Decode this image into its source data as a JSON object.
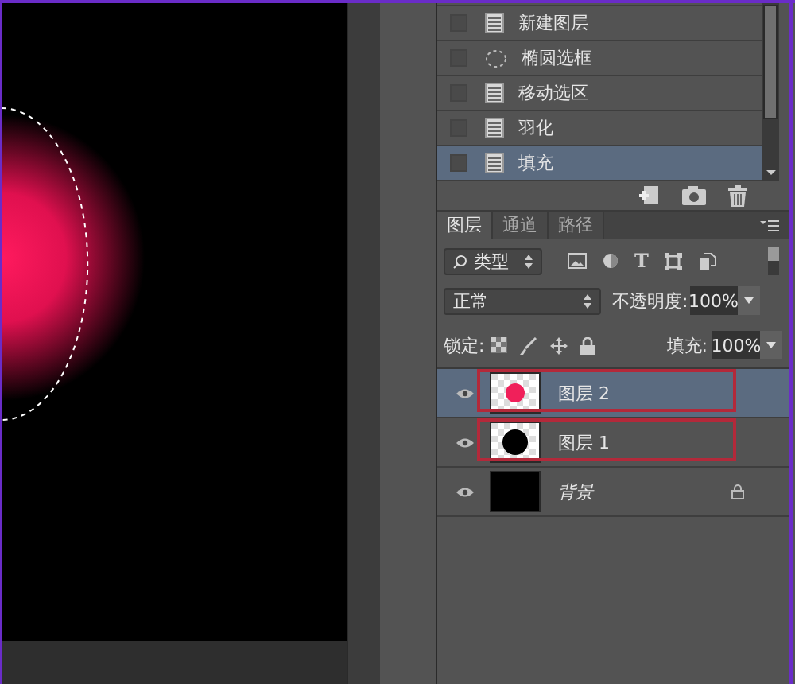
{
  "history": {
    "items": [
      {
        "label": "新建图层",
        "kind": "document",
        "selected": false
      },
      {
        "label": "椭圆选框",
        "kind": "marquee",
        "selected": false
      },
      {
        "label": "移动选区",
        "kind": "document",
        "selected": false
      },
      {
        "label": "羽化",
        "kind": "document",
        "selected": false
      },
      {
        "label": "填充",
        "kind": "document",
        "selected": true
      }
    ]
  },
  "layers_panel": {
    "tabs": [
      {
        "label": "图层",
        "selected": true
      },
      {
        "label": "通道",
        "selected": false
      },
      {
        "label": "路径",
        "selected": false
      }
    ],
    "filter": {
      "value": "类型",
      "text_icon": "T"
    },
    "blend_mode": "正常",
    "opacity": {
      "label": "不透明度:",
      "value": "100%"
    },
    "lock_label": "锁定:",
    "fill": {
      "label": "填充:",
      "value": "100%"
    },
    "layers": [
      {
        "name": "图层 2",
        "kind": "layer",
        "thumbnail": {
          "kind": "pink-dot"
        },
        "selected": true,
        "highlighted": true
      },
      {
        "name": "图层 1",
        "kind": "layer",
        "thumbnail": {
          "kind": "black-dot"
        },
        "selected": false,
        "highlighted": true
      },
      {
        "name": "背景",
        "kind": "background",
        "thumbnail": {
          "kind": "black"
        },
        "selected": false,
        "highlighted": false
      }
    ]
  }
}
